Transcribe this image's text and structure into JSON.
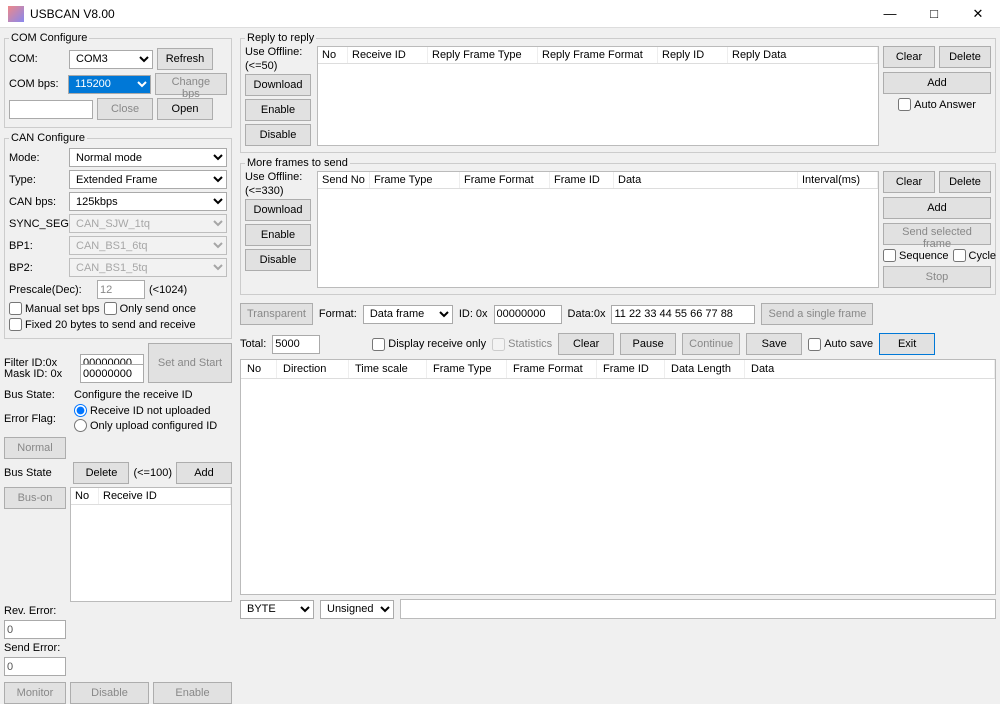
{
  "window": {
    "title": "USBCAN V8.00",
    "min": "—",
    "max": "□",
    "close": "✕"
  },
  "com_cfg": {
    "legend": "COM Configure",
    "com_lbl": "COM:",
    "com_val": "COM3",
    "refresh": "Refresh",
    "bps_lbl": "COM bps:",
    "bps_val": "115200",
    "change_bps": "Change bps",
    "close": "Close",
    "open": "Open"
  },
  "can_cfg": {
    "legend": "CAN Configure",
    "mode_lbl": "Mode:",
    "mode_val": "Normal mode",
    "type_lbl": "Type:",
    "type_val": "Extended Frame",
    "bps_lbl": "CAN bps:",
    "bps_val": "125kbps",
    "sync_lbl": "SYNC_SEG",
    "sync_val": "CAN_SJW_1tq",
    "bp1_lbl": "BP1:",
    "bp1_val": "CAN_BS1_6tq",
    "bp2_lbl": "BP2:",
    "bp2_val": "CAN_BS1_5tq",
    "presc_lbl": "Prescale(Dec):",
    "presc_val": "12",
    "presc_hint": "(<1024)",
    "manual": "Manual set bps",
    "once": "Only send once",
    "fixed20": "Fixed 20 bytes to send and receive"
  },
  "filter": {
    "fid_lbl": "Filter ID:0x",
    "fid_val": "00000000",
    "mid_lbl": "Mask ID: 0x",
    "mid_val": "00000000",
    "setstart": "Set and Start"
  },
  "bus": {
    "state_lbl": "Bus State:",
    "cfg_rx": "Configure the receive ID",
    "errflag_lbl": "Error Flag:",
    "r1": "Receive ID not uploaded",
    "r2": "Only upload configured ID",
    "normal": "Normal",
    "bs_lbl": "Bus State",
    "delete": "Delete",
    "del_hint": "(<=100)",
    "add": "Add",
    "buson": "Bus-on",
    "rid_cols": {
      "no": "No",
      "rid": "Receive ID"
    },
    "reverr_lbl": "Rev. Error:",
    "reverr_val": "0",
    "snderr_lbl": "Send Error:",
    "snderr_val": "0",
    "monitor": "Monitor",
    "disable": "Disable",
    "enable": "Enable"
  },
  "reply": {
    "legend": "Reply to reply",
    "useoff": "Use Offline:",
    "hint": "(<=50)",
    "download": "Download",
    "enable": "Enable",
    "disable": "Disable",
    "cols": {
      "no": "No",
      "rid": "Receive ID",
      "rft": "Reply Frame Type",
      "rff": "Reply Frame Format",
      "rplyid": "Reply ID",
      "rd": "Reply Data"
    },
    "clear": "Clear",
    "delete": "Delete",
    "add": "Add",
    "auto": "Auto Answer"
  },
  "more": {
    "legend": "More frames to send",
    "useoff": "Use Offline:",
    "hint": "(<=330)",
    "download": "Download",
    "enable": "Enable",
    "disable": "Disable",
    "cols": {
      "sno": "Send No",
      "ft": "Frame Type",
      "ff": "Frame Format",
      "fid": "Frame ID",
      "data": "Data",
      "intv": "Interval(ms)"
    },
    "clear": "Clear",
    "delete": "Delete",
    "add": "Add",
    "sendsel": "Send selected frame",
    "seq": "Sequence",
    "cycle": "Cycle",
    "stop": "Stop"
  },
  "single": {
    "transparent": "Transparent",
    "format_lbl": "Format:",
    "format_val": "Data frame",
    "id_lbl": "ID: 0x",
    "id_val": "00000000",
    "data_lbl": "Data:0x",
    "data_val": "11 22 33 44 55 66 77 88",
    "send1": "Send a single frame"
  },
  "logctrl": {
    "total_lbl": "Total:",
    "total_val": "5000",
    "disprx": "Display receive only",
    "stats": "Statistics",
    "clear": "Clear",
    "pause": "Pause",
    "cont": "Continue",
    "save": "Save",
    "autosave": "Auto save",
    "exit": "Exit"
  },
  "log_cols": {
    "no": "No",
    "dir": "Direction",
    "ts": "Time scale",
    "ft": "Frame Type",
    "ff": "Frame Format",
    "fid": "Frame ID",
    "dl": "Data Length",
    "data": "Data"
  },
  "bottom": {
    "byte": "BYTE",
    "unsigned": "Unsigned"
  }
}
